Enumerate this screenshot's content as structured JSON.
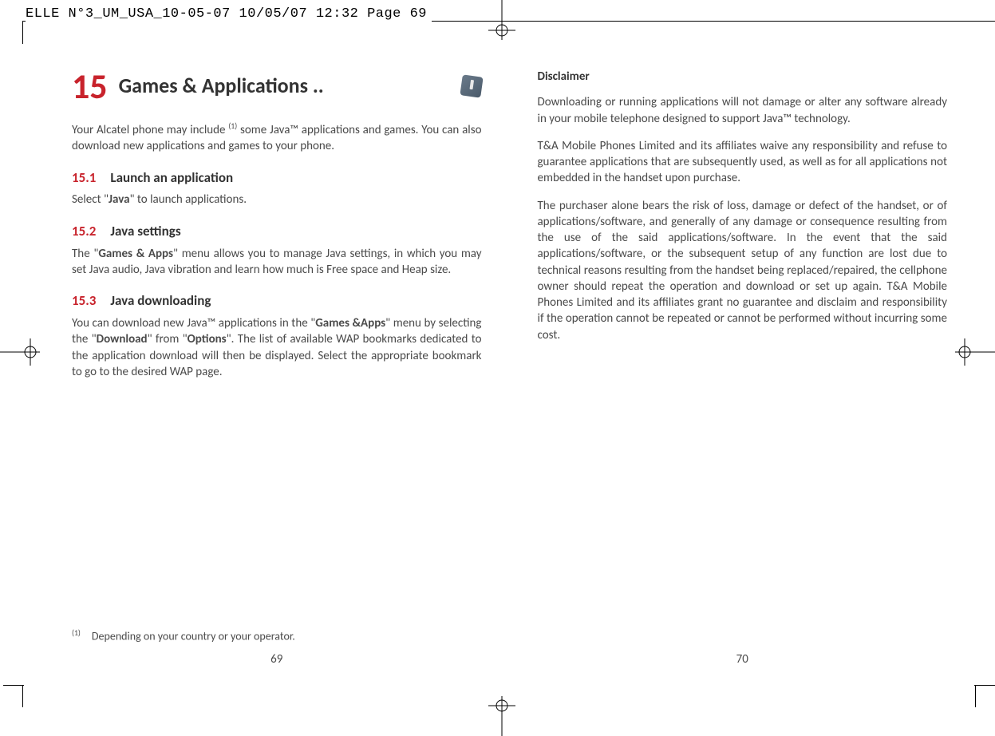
{
  "header": "ELLE N°3_UM_USA_10-05-07  10/05/07  12:32  Page 69",
  "chapter": {
    "num": "15",
    "title": "Games & Applications ..",
    "icon_name": "java-app-icon"
  },
  "intro_before_sup": "Your Alcatel phone may include ",
  "intro_sup": "(1)",
  "intro_after_sup": " some Java™ applications and games. You can also download new applications and games to your phone.",
  "sections": {
    "s1": {
      "num": "15.1",
      "title": "Launch an application",
      "body_before": "Select \"",
      "body_bold": "Java",
      "body_after": "\" to launch applications."
    },
    "s2": {
      "num": "15.2",
      "title": "Java settings",
      "body_before": "The \"",
      "body_bold": "Games & Apps",
      "body_after": "\" menu allows you to manage Java settings, in which you may set Java audio, Java vibration and learn how much is Free space and Heap size."
    },
    "s3": {
      "num": "15.3",
      "title": "Java downloading",
      "p_a": "You can download new Java™ applications in the \"",
      "p_b": "Games &Apps",
      "p_c": "\" menu by selecting the \"",
      "p_d": "Download",
      "p_e": "\" from \"",
      "p_f": "Options",
      "p_g": "\". The list of available WAP bookmarks dedicated to the application download will then be displayed. Select the appropriate bookmark to go to the desired WAP page."
    }
  },
  "footnote": {
    "mark": "(1)",
    "text": "Depending on your country or your operator."
  },
  "page_left_num": "69",
  "disclaimer": {
    "head": "Disclaimer",
    "p1": "Downloading or running applications will not damage or alter any software already in your mobile telephone designed to support Java™ technology.",
    "p2": "T&A Mobile Phones Limited and its affiliates waive any responsibility and refuse to guarantee applications that are subsequently used, as well as for all applications not embedded in the handset upon purchase.",
    "p3": "The purchaser alone bears the risk of loss, damage or defect of the handset, or of applications/software, and generally of any damage or consequence resulting from the use of the said applications/software. In the event that the said applications/software, or the subsequent setup of any function are lost due to technical reasons resulting from the handset being replaced/repaired, the cellphone owner should repeat the operation and download or set up again. T&A Mobile Phones Limited and its affiliates grant no guarantee and disclaim and responsibility if the operation cannot be repeated or cannot be performed without incurring some cost."
  },
  "page_right_num": "70"
}
